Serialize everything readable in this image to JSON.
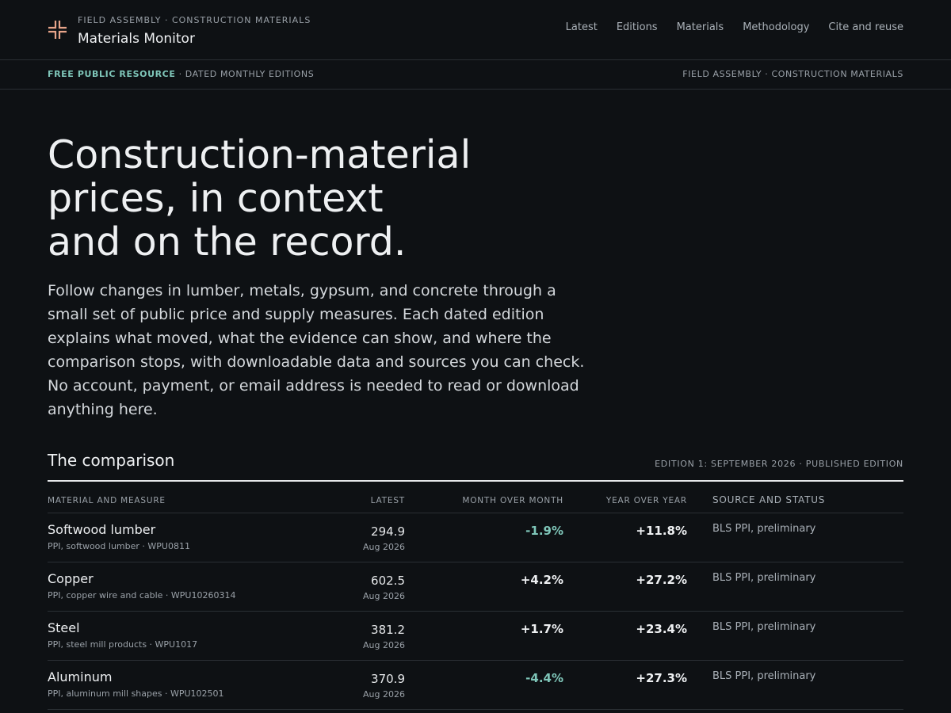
{
  "header": {
    "kicker": "FIELD ASSEMBLY · CONSTRUCTION MATERIALS",
    "site_title": "Materials Monitor",
    "logo_icon": "bracket-cross-icon",
    "accent_color": "#e8a58a",
    "nav": [
      {
        "label": "Latest"
      },
      {
        "label": "Editions"
      },
      {
        "label": "Materials"
      },
      {
        "label": "Methodology"
      },
      {
        "label": "Cite and reuse"
      }
    ]
  },
  "banner": {
    "highlight": "FREE PUBLIC RESOURCE",
    "separator": " · ",
    "rest": "DATED MONTHLY EDITIONS",
    "right": "FIELD ASSEMBLY · CONSTRUCTION MATERIALS"
  },
  "hero": {
    "title": "Construction-material\nprices, in context\nand on the record.",
    "body": "Follow changes in lumber, metals, gypsum, and concrete through a small set of public price and supply measures. Each dated edition explains what moved, what the evidence can show, and where the comparison stops, with downloadable data and sources you can check. No account, payment, or email address is needed to read or download anything here."
  },
  "comparison": {
    "title": "The comparison",
    "edition": "EDITION 1: SEPTEMBER 2026 · PUBLISHED EDITION",
    "columns": {
      "material": "MATERIAL AND MEASURE",
      "latest": "LATEST",
      "mom": "MONTH OVER MONTH",
      "yoy": "YEAR OVER YEAR",
      "source": "SOURCE AND STATUS"
    },
    "rows": [
      {
        "name": "Softwood lumber",
        "measure": "PPI, softwood lumber · WPU0811",
        "latest": "294.9",
        "date": "Aug 2026",
        "mom": "-1.9%",
        "yoy": "+11.8%",
        "source": "BLS PPI, preliminary"
      },
      {
        "name": "Copper",
        "measure": "PPI, copper wire and cable · WPU10260314",
        "latest": "602.5",
        "date": "Aug 2026",
        "mom": "+4.2%",
        "yoy": "+27.2%",
        "source": "BLS PPI, preliminary"
      },
      {
        "name": "Steel",
        "measure": "PPI, steel mill products · WPU1017",
        "latest": "381.2",
        "date": "Aug 2026",
        "mom": "+1.7%",
        "yoy": "+23.4%",
        "source": "BLS PPI, preliminary"
      },
      {
        "name": "Aluminum",
        "measure": "PPI, aluminum mill shapes · WPU102501",
        "latest": "370.9",
        "date": "Aug 2026",
        "mom": "-4.4%",
        "yoy": "+27.3%",
        "source": "BLS PPI, preliminary"
      }
    ]
  }
}
